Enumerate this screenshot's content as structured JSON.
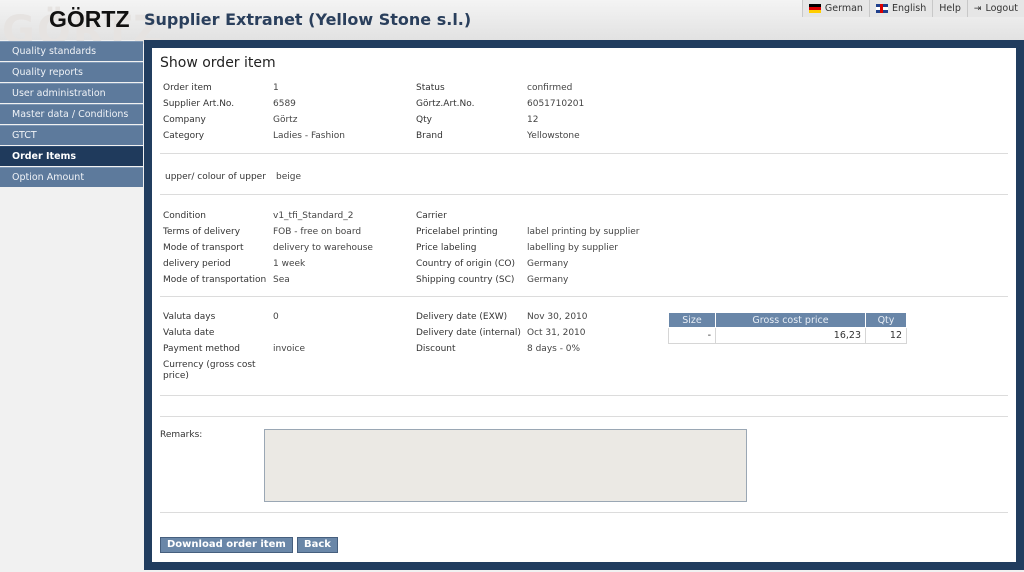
{
  "header": {
    "watermark": "GÖRTZ",
    "logo": "GÖRTZ",
    "app_title": "Supplier Extranet (Yellow Stone s.l.)",
    "nav": [
      {
        "label": "German",
        "icon": "flag-de-icon"
      },
      {
        "label": "English",
        "icon": "flag-uk-icon"
      },
      {
        "label": "Help"
      },
      {
        "label": "Logout",
        "icon": "logout-icon"
      }
    ]
  },
  "sidebar": {
    "items": [
      {
        "label": "Quality standards",
        "active": false
      },
      {
        "label": "Quality reports",
        "active": false
      },
      {
        "label": "User administration",
        "active": false
      },
      {
        "label": "Master data / Conditions",
        "active": false
      },
      {
        "label": "GTCT",
        "active": false
      },
      {
        "label": "Order Items",
        "active": true
      },
      {
        "label": "Option Amount",
        "active": false
      }
    ]
  },
  "page": {
    "title": "Show order item",
    "section1": {
      "left": [
        {
          "label": "Order item",
          "value": "1"
        },
        {
          "label": "Supplier Art.No.",
          "value": "6589"
        },
        {
          "label": "Company",
          "value": "Görtz"
        },
        {
          "label": "Category",
          "value": "Ladies - Fashion"
        }
      ],
      "right": [
        {
          "label": "Status",
          "value": "confirmed"
        },
        {
          "label": "Görtz.Art.No.",
          "value": "6051710201"
        },
        {
          "label": "Qty",
          "value": "12"
        },
        {
          "label": "Brand",
          "value": "Yellowstone"
        }
      ]
    },
    "section2": {
      "label": "upper/ colour of upper",
      "value": "beige"
    },
    "section3": {
      "left": [
        {
          "label": "Condition",
          "value": "v1_tfi_Standard_2"
        },
        {
          "label": "Terms of delivery",
          "value": "FOB - free on board"
        },
        {
          "label": "Mode of transport",
          "value": "delivery to warehouse"
        },
        {
          "label": "delivery period",
          "value": "1 week"
        },
        {
          "label": "Mode of transportation",
          "value": "Sea"
        }
      ],
      "right": [
        {
          "label": "Carrier",
          "value": ""
        },
        {
          "label": "Pricelabel printing",
          "value": "label printing by supplier"
        },
        {
          "label": "Price labeling",
          "value": "labelling by supplier"
        },
        {
          "label": "Country of origin (CO)",
          "value": "Germany"
        },
        {
          "label": "Shipping country (SC)",
          "value": "Germany"
        }
      ]
    },
    "section4": {
      "left": [
        {
          "label": "Valuta days",
          "value": "0"
        },
        {
          "label": "Valuta date",
          "value": ""
        },
        {
          "label": "Payment method",
          "value": "invoice"
        },
        {
          "label": "Currency (gross cost",
          "label2": "price)",
          "value": ""
        }
      ],
      "right": [
        {
          "label": "Delivery date (EXW)",
          "value": "Nov 30, 2010"
        },
        {
          "label": "Delivery date (internal)",
          "value": "Oct 31, 2010"
        },
        {
          "label": "Discount",
          "value": "8 days - 0%"
        }
      ],
      "table": {
        "headers": [
          "Size",
          "Gross cost price",
          "Qty"
        ],
        "rows": [
          [
            "-",
            "16,23",
            "12"
          ]
        ]
      }
    },
    "remarks": {
      "label": "Remarks:",
      "value": ""
    },
    "buttons": {
      "download": "Download order item",
      "back": "Back"
    }
  }
}
